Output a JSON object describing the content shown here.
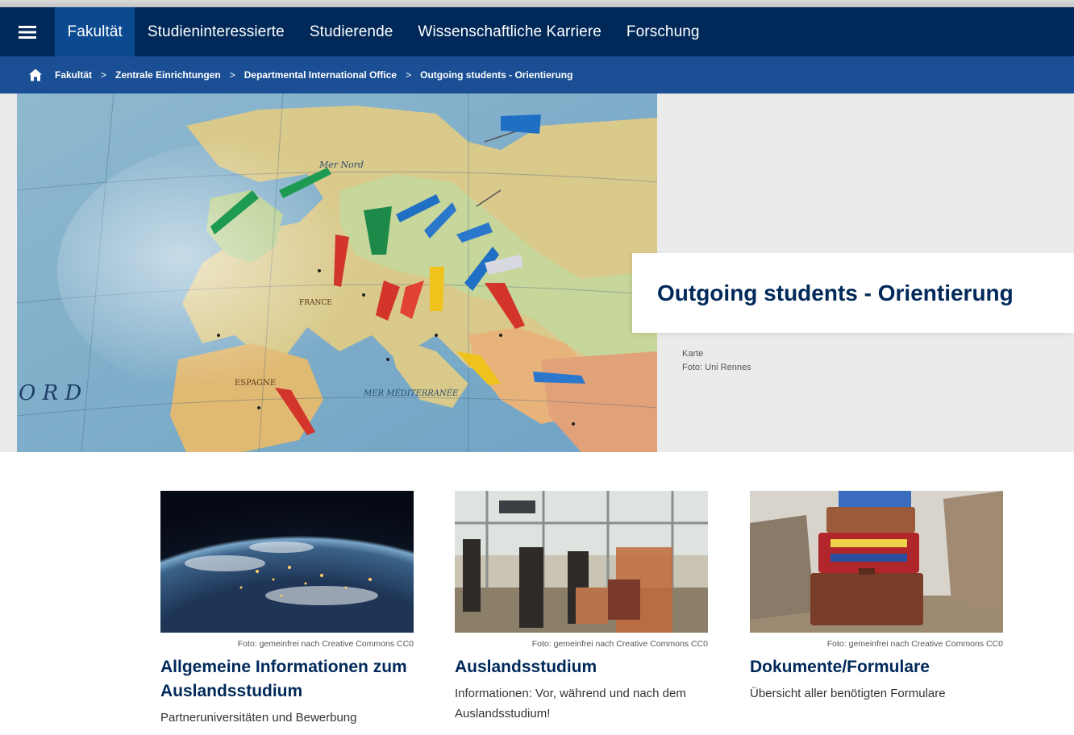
{
  "nav": {
    "menu_icon": "hamburger-icon",
    "items": [
      {
        "label": "Fakultät",
        "active": true
      },
      {
        "label": "Studieninteressierte",
        "active": false
      },
      {
        "label": "Studierende",
        "active": false
      },
      {
        "label": "Wissenschaftliche Karriere",
        "active": false
      },
      {
        "label": "Forschung",
        "active": false
      }
    ],
    "colors": {
      "bar": "#00295a",
      "active": "#0b4a91"
    }
  },
  "breadcrumb": {
    "home_icon": "home-icon",
    "items": [
      "Fakultät",
      "Zentrale Einrichtungen",
      "Departmental International Office",
      "Outgoing students - Orientierung"
    ],
    "separator": ">"
  },
  "hero": {
    "title": "Outgoing students - Orientierung",
    "caption_line1": "Karte",
    "caption_line2": "Foto: Uni Rennes",
    "map_labels": {
      "ord": "O R D",
      "mer_nord": "Mer  Nord",
      "france": "FRANCE",
      "espagne": "ESPAGNE",
      "mer_med": "MER  MÉDITERRANÉE"
    }
  },
  "cards": [
    {
      "credit": "Foto: gemeinfrei nach Creative Commons CC0",
      "title": "Allgemeine Informationen zum Auslandsstudium",
      "text": "Partneruniversitäten und Bewerbung"
    },
    {
      "credit": "Foto: gemeinfrei nach Creative Commons CC0",
      "title": "Auslandsstudium",
      "text": "Informationen: Vor, während und nach dem Auslandsstudium!"
    },
    {
      "credit": "Foto: gemeinfrei nach Creative Commons CC0",
      "title": "Dokumente/Formulare",
      "text": "Übersicht aller benötigten Formulare"
    }
  ]
}
